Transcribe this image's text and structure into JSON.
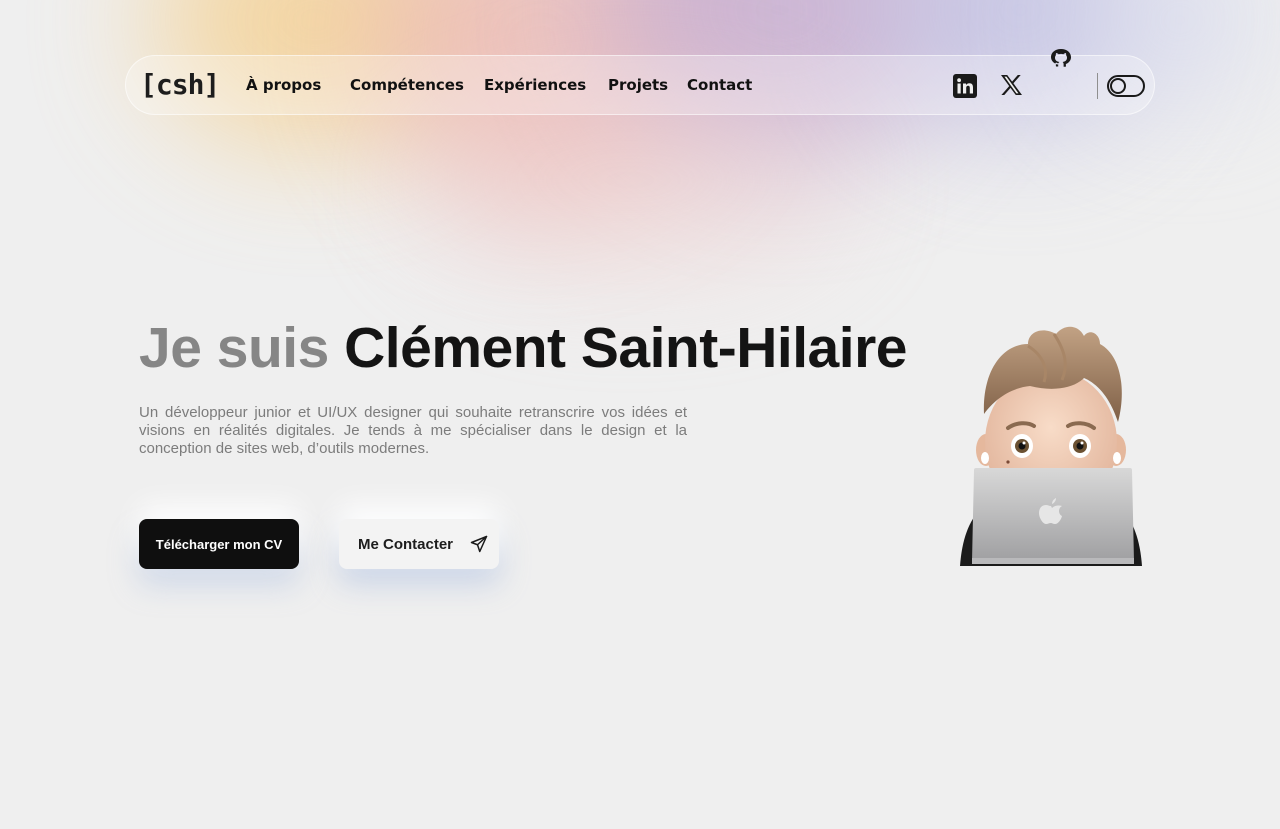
{
  "logo": {
    "text": "[csh]"
  },
  "nav": {
    "links": [
      {
        "label": "À propos"
      },
      {
        "label": "Compétences"
      },
      {
        "label": "Expériences"
      },
      {
        "label": "Projets"
      },
      {
        "label": "Contact"
      }
    ]
  },
  "social": {
    "icons": [
      "linkedin-icon",
      "x-twitter-icon",
      "github-icon"
    ]
  },
  "theme_toggle": {
    "state": "off"
  },
  "hero": {
    "prefix": "Je suis",
    "name": "Clément Saint-Hilaire",
    "description": "Un développeur junior et UI/UX designer qui souhaite retranscrire vos idées et visions en réalités digitales. Je tends à me spécialiser dans le design et la conception de sites web, d’outils modernes."
  },
  "buttons": {
    "download_cv": "Télécharger mon CV",
    "contact": "Me Contacter"
  },
  "colors": {
    "background": "#efefef",
    "text_dark": "#141414",
    "text_muted": "#868686",
    "button_dark": "#0f0f0f"
  }
}
